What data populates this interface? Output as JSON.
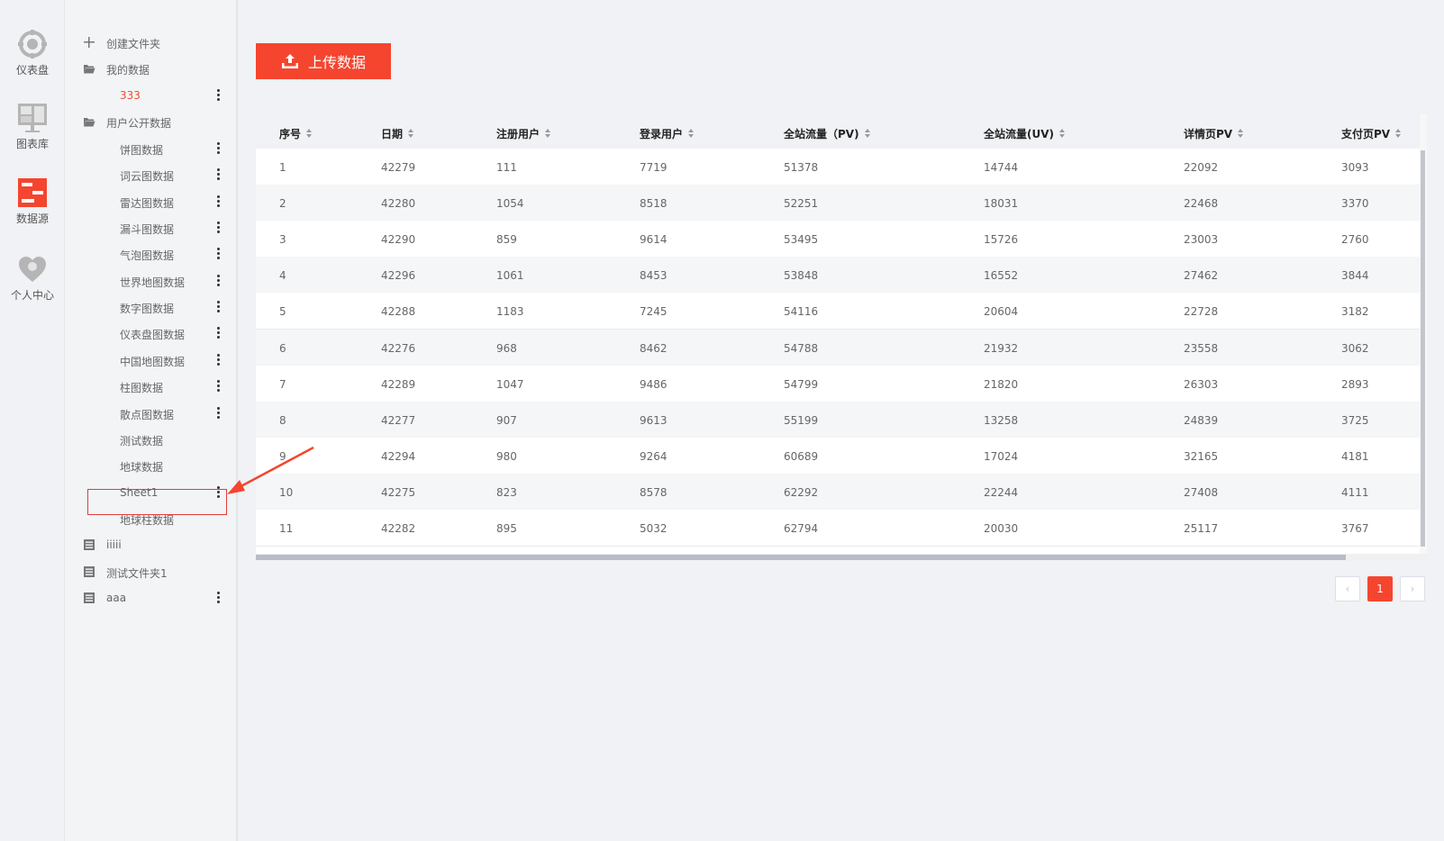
{
  "rail": {
    "items": [
      {
        "label": "仪表盘",
        "icon": "gauge-icon"
      },
      {
        "label": "图表库",
        "icon": "chart-library-icon"
      },
      {
        "label": "数据源",
        "icon": "data-source-icon"
      },
      {
        "label": "个人中心",
        "icon": "user-center-icon"
      }
    ]
  },
  "tree": {
    "create_folder": "创建文件夹",
    "my_data": "我的数据",
    "my_data_children": [
      "333"
    ],
    "public_data": "用户公开数据",
    "public_children": [
      "饼图数据",
      "词云图数据",
      "雷达图数据",
      "漏斗图数据",
      "气泡图数据",
      "世界地图数据",
      "数字图数据",
      "仪表盘图数据",
      "中国地图数据",
      "柱图数据",
      "散点图数据",
      "测试数据",
      "地球数据",
      "Sheet1",
      "地球柱数据"
    ],
    "other_folders": [
      "iiiii",
      "测试文件夹1",
      "aaa"
    ]
  },
  "toolbar": {
    "upload_label": "上传数据"
  },
  "table": {
    "headers": [
      "序号",
      "日期",
      "注册用户",
      "登录用户",
      "全站流量（PV)",
      "全站流量(UV)",
      "详情页PV",
      "支付页PV"
    ],
    "rows": [
      [
        "1",
        "42279",
        "111",
        "7719",
        "51378",
        "14744",
        "22092",
        "3093"
      ],
      [
        "2",
        "42280",
        "1054",
        "8518",
        "52251",
        "18031",
        "22468",
        "3370"
      ],
      [
        "3",
        "42290",
        "859",
        "9614",
        "53495",
        "15726",
        "23003",
        "2760"
      ],
      [
        "4",
        "42296",
        "1061",
        "8453",
        "53848",
        "16552",
        "27462",
        "3844"
      ],
      [
        "5",
        "42288",
        "1183",
        "7245",
        "54116",
        "20604",
        "22728",
        "3182"
      ],
      [
        "6",
        "42276",
        "968",
        "8462",
        "54788",
        "21932",
        "23558",
        "3062"
      ],
      [
        "7",
        "42289",
        "1047",
        "9486",
        "54799",
        "21820",
        "26303",
        "2893"
      ],
      [
        "8",
        "42277",
        "907",
        "9613",
        "55199",
        "13258",
        "24839",
        "3725"
      ],
      [
        "9",
        "42294",
        "980",
        "9264",
        "60689",
        "17024",
        "32165",
        "4181"
      ],
      [
        "10",
        "42275",
        "823",
        "8578",
        "62292",
        "22244",
        "27408",
        "4111"
      ],
      [
        "11",
        "42282",
        "895",
        "5032",
        "62794",
        "20030",
        "25117",
        "3767"
      ]
    ]
  },
  "pagination": {
    "prev": "‹",
    "current": "1",
    "next": "›"
  },
  "colors": {
    "accent": "#f5452f",
    "selection_border": "#e23d3d"
  }
}
